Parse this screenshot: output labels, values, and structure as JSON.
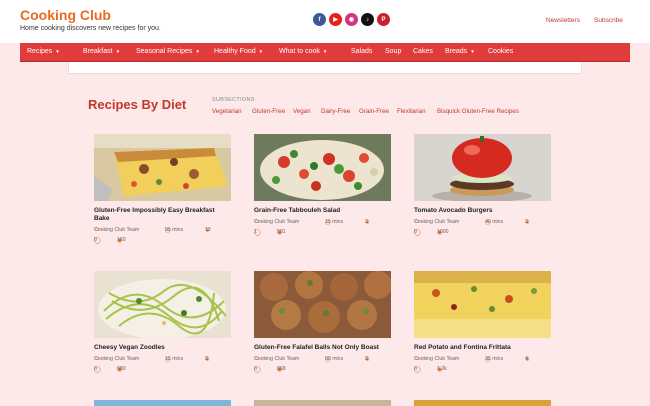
{
  "site": {
    "title": "Cooking Club",
    "tagline": "Home cooking discovers new recipes for you.",
    "top_links": [
      "Newsletters",
      "Subscribe"
    ],
    "social_icons": [
      "facebook-icon",
      "youtube-icon",
      "instagram-icon",
      "tiktok-icon",
      "pinterest-icon"
    ],
    "accent": "#e86b1f",
    "nav_color": "#e03c3c"
  },
  "nav": [
    {
      "label": "Recipes",
      "dropdown": true
    },
    {
      "label": "Breakfast",
      "dropdown": true
    },
    {
      "label": "Seasonal Recipes",
      "dropdown": true
    },
    {
      "label": "Healthy Food",
      "dropdown": true
    },
    {
      "label": "What to cook",
      "dropdown": true
    },
    {
      "label": "Salads",
      "dropdown": false
    },
    {
      "label": "Soup",
      "dropdown": false
    },
    {
      "label": "Cakes",
      "dropdown": false
    },
    {
      "label": "Breads",
      "dropdown": true
    },
    {
      "label": "Cookies",
      "dropdown": false
    }
  ],
  "section": {
    "title": "Recipes By Diet",
    "subsections_label": "SUBSECTIONS",
    "subsections": [
      "Vegetarian",
      "Gluten-Free",
      "Vegan",
      "Dairy-Free",
      "Grain-Free",
      "Flexitarian",
      "Bisquick Gluten-Free Recipes"
    ]
  },
  "cards": [
    {
      "title": "Gluten-Free Impossibly Easy Breakfast Bake",
      "author": "Cooking Club Team",
      "time": "55 mins",
      "servings": "12",
      "comments": "0",
      "views": "160"
    },
    {
      "title": "Grain-Free Tabbouleh Salad",
      "author": "Cooking Club Team",
      "time": "15 mins",
      "servings": "2",
      "comments": "1",
      "views": "591"
    },
    {
      "title": "Tomato Avocado Burgers",
      "author": "Cooking Club Team",
      "time": "40 mins",
      "servings": "2",
      "comments": "0",
      "views": "1000"
    },
    {
      "title": "Cheesy Vegan Zoodles",
      "author": "Cooking Club Team",
      "time": "15 mins",
      "servings": "2",
      "comments": "0",
      "views": "680"
    },
    {
      "title": "Gluten-Free Falafel Balls Not Only Boast",
      "author": "Cooking Club Team",
      "time": "50 mins",
      "servings": "2",
      "comments": "0",
      "views": "868"
    },
    {
      "title": "Red Potato and Fontina Frittata",
      "author": "Cooking Club Team",
      "time": "35 mins",
      "servings": "4",
      "comments": "0",
      "views": "1.2k"
    }
  ]
}
